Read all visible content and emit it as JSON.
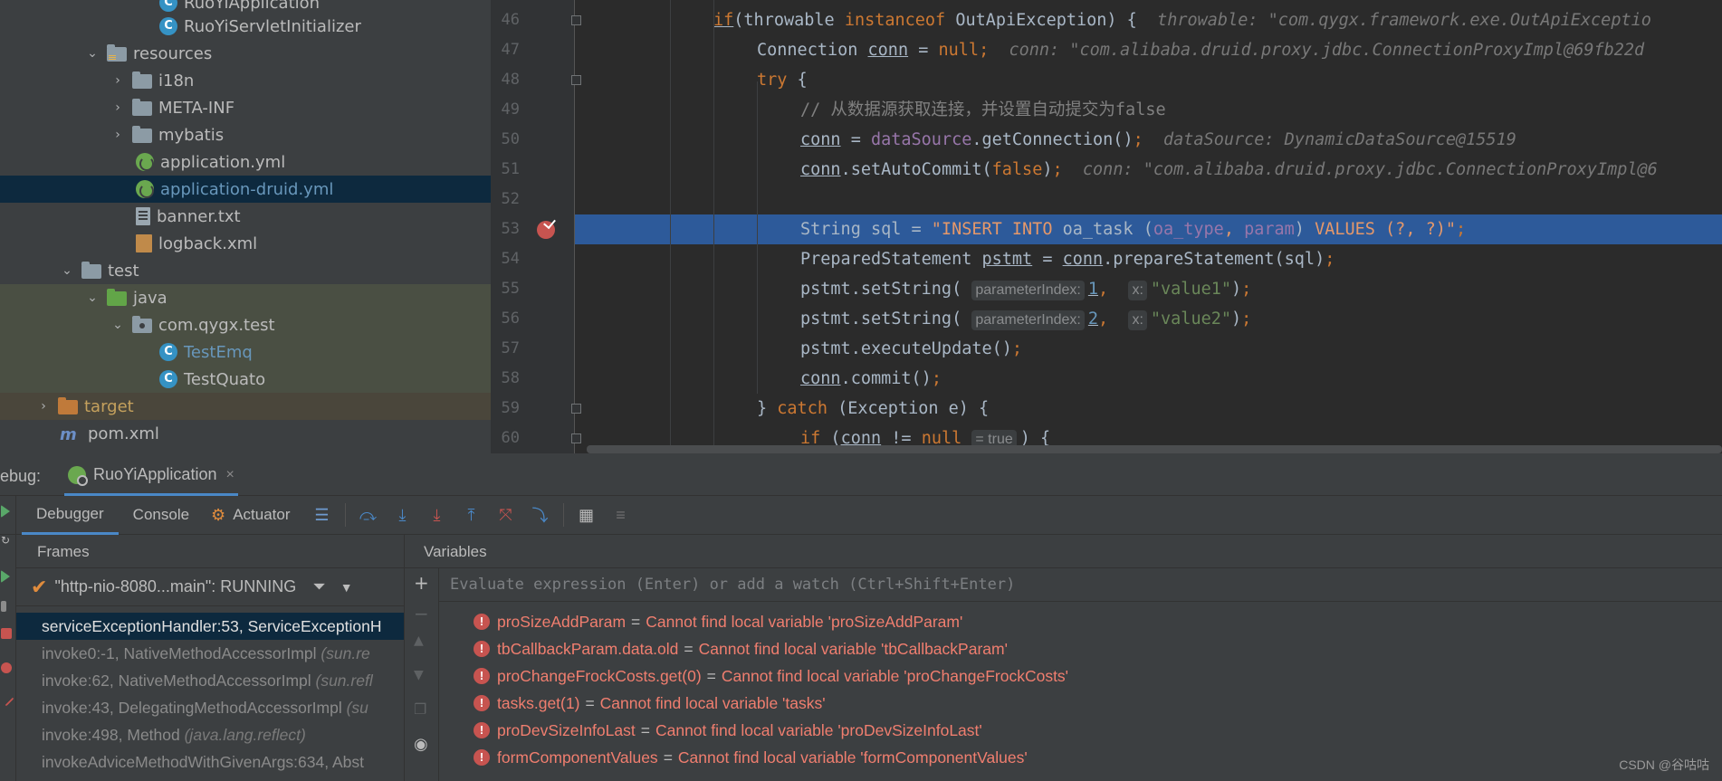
{
  "project_tree": {
    "items": [
      {
        "label": "RuoYiApplication",
        "icon": "java-class-icon"
      },
      {
        "label": "RuoYiServletInitializer",
        "icon": "java-class-icon"
      },
      {
        "label": "resources",
        "icon": "resources-folder-icon"
      },
      {
        "label": "i18n",
        "icon": "folder-icon"
      },
      {
        "label": "META-INF",
        "icon": "folder-icon"
      },
      {
        "label": "mybatis",
        "icon": "folder-icon"
      },
      {
        "label": "application.yml",
        "icon": "yaml-file-icon"
      },
      {
        "label": "application-druid.yml",
        "icon": "yaml-file-icon"
      },
      {
        "label": "banner.txt",
        "icon": "text-file-icon"
      },
      {
        "label": "logback.xml",
        "icon": "xml-file-icon"
      },
      {
        "label": "test",
        "icon": "folder-icon"
      },
      {
        "label": "java",
        "icon": "test-source-folder-icon"
      },
      {
        "label": "com.qygx.test",
        "icon": "package-icon"
      },
      {
        "label": "TestEmq",
        "icon": "java-class-icon"
      },
      {
        "label": "TestQuato",
        "icon": "java-class-icon"
      },
      {
        "label": "target",
        "icon": "excluded-folder-icon"
      },
      {
        "label": "pom.xml",
        "icon": "maven-icon"
      }
    ]
  },
  "editor": {
    "line_numbers": [
      "46",
      "47",
      "48",
      "49",
      "50",
      "51",
      "52",
      "53",
      "54",
      "55",
      "56",
      "57",
      "58",
      "59",
      "60"
    ],
    "code": {
      "l46_if": "if",
      "l46_a": "(throwable ",
      "l46_kw": "instanceof",
      "l46_b": " OutApiException) {",
      "l46_inline": "throwable: \"com.qygx.framework.exe.OutApiExceptio",
      "l47_a": "Connection ",
      "l47_conn": "conn",
      "l47_b": " = ",
      "l47_null": "null",
      "l47_c": ";",
      "l47_inline": "conn: \"com.alibaba.druid.proxy.jdbc.ConnectionProxyImpl@69fb22d",
      "l48_try": "try",
      "l48_b": " {",
      "l49_comment": "// 从数据源获取连接，并设置自动提交为false",
      "l50_conn": "conn",
      "l50_a": " = ",
      "l50_ds": "dataSource",
      "l50_b": ".getConnection()",
      "l50_c": ";",
      "l50_inline": "dataSource: DynamicDataSource@15519",
      "l51_conn": "conn",
      "l51_a": ".setAutoCommit(",
      "l51_false": "false",
      "l51_b": ")",
      "l51_c": ";",
      "l51_inline": "conn: \"com.alibaba.druid.proxy.jdbc.ConnectionProxyImpl@6",
      "l53_a": "String sql = ",
      "l53_s1": "\"INSERT INTO ",
      "l53_s2": "oa_task (",
      "l53_f1": "oa_type",
      "l53_s3": ", ",
      "l53_f2": "param",
      "l53_s4": ") ",
      "l53_s5": "VALUES",
      "l53_s6": " (?, ?)\"",
      "l53_c": ";",
      "l54_a": "PreparedStatement ",
      "l54_pstmt": "pstmt",
      "l54_b": " = ",
      "l54_conn": "conn",
      "l54_c": ".prepareStatement(sql)",
      "l54_d": ";",
      "l55_a": "pstmt.setString(",
      "hint_param_index": "parameterIndex:",
      "l55_n": "1",
      "comma": ",",
      "hint_x": "x:",
      "l55_s": "\"value1\"",
      "l55_b": ")",
      "semi": ";",
      "l56_a": "pstmt.setString(",
      "l56_n": "2",
      "l56_s": "\"value2\"",
      "l56_b": ")",
      "l57_a": "pstmt.executeUpdate()",
      "l58_conn": "conn",
      "l58_a": ".commit()",
      "l59_a": "} ",
      "l59_catch": "catch",
      "l59_b": " (Exception e) {",
      "l60_if": "if",
      "l60_a": " (",
      "l60_conn": "conn",
      "l60_b": " != ",
      "l60_null": "null",
      "l60_hint": "= true",
      "l60_c": ") {"
    }
  },
  "debug": {
    "title": "ebug:",
    "run_config": "RuoYiApplication",
    "close": "×",
    "tabs": [
      "Debugger",
      "Console",
      "Actuator"
    ],
    "frames_title": "Frames",
    "variables_title": "Variables",
    "thread": "\"http-nio-8080...main\": RUNNING",
    "frames": [
      {
        "method": "serviceExceptionHandler:53, ServiceExceptionH",
        "pkg": ""
      },
      {
        "method": "invoke0:-1, NativeMethodAccessorImpl ",
        "pkg": "(sun.re"
      },
      {
        "method": "invoke:62, NativeMethodAccessorImpl ",
        "pkg": "(sun.refl"
      },
      {
        "method": "invoke:43, DelegatingMethodAccessorImpl ",
        "pkg": "(su"
      },
      {
        "method": "invoke:498, Method ",
        "pkg": "(java.lang.reflect)"
      },
      {
        "method": "invokeAdviceMethodWithGivenArgs:634, Abst",
        "pkg": ""
      }
    ],
    "evaluate_placeholder": "Evaluate expression (Enter) or add a watch (Ctrl+Shift+Enter)",
    "variables": [
      {
        "name": "proSizeAddParam",
        "value": "Cannot find local variable 'proSizeAddParam'"
      },
      {
        "name": "tbCallbackParam.data.old",
        "value": "Cannot find local variable 'tbCallbackParam'"
      },
      {
        "name": "proChangeFrockCosts.get(0)",
        "value": "Cannot find local variable 'proChangeFrockCosts'"
      },
      {
        "name": "tasks.get(1)",
        "value": "Cannot find local variable 'tasks'"
      },
      {
        "name": "proDevSizeInfoLast",
        "value": "Cannot find local variable 'proDevSizeInfoLast'"
      },
      {
        "name": "formComponentValues",
        "value": "Cannot find local variable 'formComponentValues'"
      }
    ],
    "equals": "="
  },
  "watermark": "CSDN @谷咕咕",
  "colors": {
    "keyword": "#cc7832",
    "number": "#6897bb",
    "string": "#6a8759",
    "field": "#9876aa",
    "selection_line": "#2d5a9a",
    "error": "#c75450",
    "error_text": "#f07e6f"
  }
}
